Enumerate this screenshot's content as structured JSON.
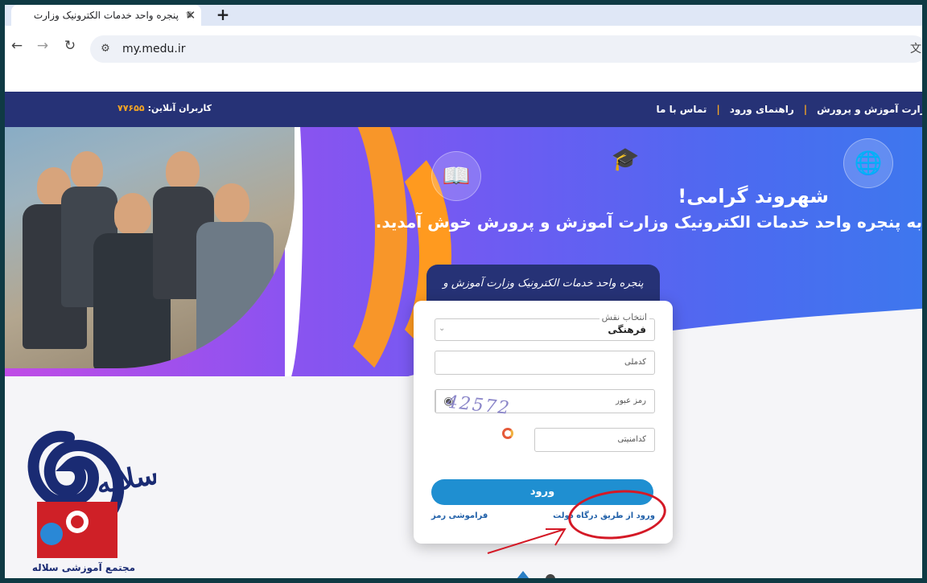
{
  "browser": {
    "tab_title": "پنجره واحد خدمات الکترونیک وزارت",
    "url": "my.medu.ir"
  },
  "header": {
    "nav": [
      "وزارت آموزش و پرورش",
      "راهنمای ورود",
      "تماس با ما"
    ],
    "online_label": "کاربران آنلاین:",
    "online_count": "۷۷۶۵۵"
  },
  "hero": {
    "greeting": "شهروند گرامی!",
    "welcome": "به پنجره واحد خدمات الکترونیک وزارت آموزش و پرورش خوش آمدید."
  },
  "login": {
    "banner": "پنجره واحد خدمات الکترونیک وزارت آموزش و پرورش",
    "role_label": "انتخاب نقش",
    "role_value": "فرهنگی",
    "national_code_placeholder": "کدملی",
    "password_placeholder": "رمز عبور",
    "captcha_placeholder": "کدامنیتی",
    "captcha_text": "42572",
    "submit": "ورود",
    "gov_gateway_link": "ورود از طریق درگاه دولت",
    "forgot_link": "فراموشی رمز"
  },
  "watermark": {
    "logo_text": "سلاله",
    "caption": "مجتمع آموزشی سلاله"
  }
}
